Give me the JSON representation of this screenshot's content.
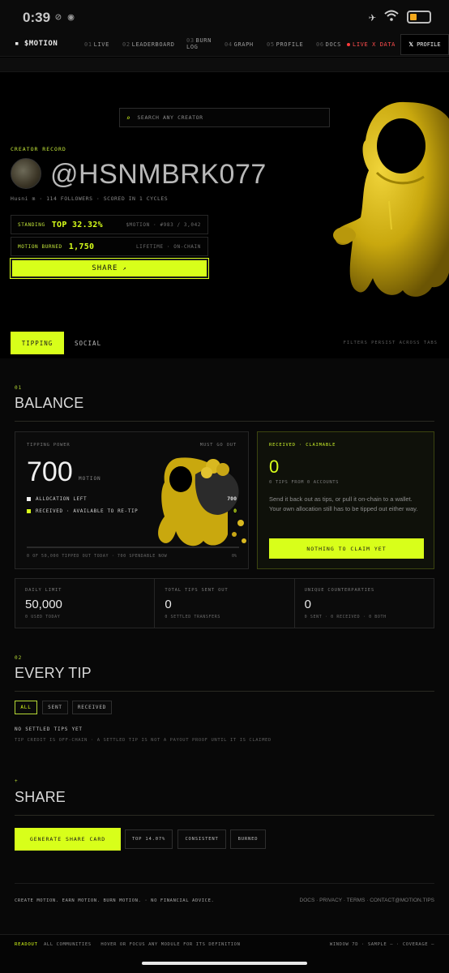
{
  "status_bar": {
    "time": "0:39"
  },
  "nav": {
    "brand": "$MOTION",
    "items": [
      {
        "num": "01",
        "label": "LIVE"
      },
      {
        "num": "02",
        "label": "LEADERBOARD"
      },
      {
        "num": "03",
        "label": "BURN"
      },
      {
        "num": "",
        "label": "LOG"
      },
      {
        "num": "04",
        "label": "GRAPH"
      },
      {
        "num": "05",
        "label": "PROFILE"
      },
      {
        "num": "06",
        "label": "DOCS"
      }
    ],
    "live": "LIVE X DATA",
    "profile_button": "PROFILE"
  },
  "hero": {
    "search_placeholder": "SEARCH ANY CREATOR",
    "creator_label": "CREATOR RECORD",
    "handle": "@HSNMBRK077",
    "meta": "Husni m · 114 FOLLOWERS · SCORED IN 1 CYCLES",
    "standing": {
      "label": "STANDING",
      "value": "TOP 32.32%",
      "right": "$MOTION · #983 / 3,042"
    },
    "burned": {
      "label": "MOTION BURNED",
      "value": "1,750",
      "right": "LIFETIME · ON-CHAIN"
    },
    "share_button": "SHARE",
    "share_arrow": "↗"
  },
  "tabs": {
    "active": "TIPPING",
    "other": "SOCIAL",
    "note": "FILTERS PERSIST ACROSS TABS"
  },
  "balance": {
    "num": "01",
    "title": "BALANCE",
    "power": {
      "label": "TIPPING POWER",
      "must": "MUST GO OUT",
      "value": "700",
      "unit": "MOTION",
      "allocation_label": "ALLOCATION LEFT",
      "allocation_value": "700",
      "received_label": "RECEIVED · AVAILABLE TO RE-TIP",
      "received_value": "0",
      "footer": "0 OF 50,000 TIPPED OUT TODAY · 700 SPENDABLE NOW",
      "pct": "0%",
      "progress": 0
    },
    "claim": {
      "label": "RECEIVED · CLAIMABLE",
      "value": "0",
      "sub": "0 TIPS FROM 0 ACCOUNTS",
      "text": "Send it back out as tips, or pull it on-chain to a wallet. Your own allocation still has to be tipped out either way.",
      "button": "NOTHING TO CLAIM YET"
    },
    "stats": [
      {
        "label": "DAILY LIMIT",
        "value": "50,000",
        "sub": "0 USED TODAY"
      },
      {
        "label": "TOTAL TIPS SENT OUT",
        "value": "0",
        "sub": "0 SETTLED TRANSFERS"
      },
      {
        "label": "UNIQUE COUNTERPARTIES",
        "value": "0",
        "sub": "0 SENT · 0 RECEIVED · 0 BOTH"
      }
    ]
  },
  "every_tip": {
    "num": "02",
    "title": "EVERY TIP",
    "filters": [
      "ALL",
      "SENT",
      "RECEIVED"
    ],
    "empty": "NO SETTLED TIPS YET",
    "disclaimer": "TIP CREDIT IS OFF-CHAIN · A SETTLED TIP IS NOT A PAYOUT PROOF UNTIL IT IS CLAIMED"
  },
  "share": {
    "num": "+",
    "title": "SHARE",
    "generate": "GENERATE SHARE CARD",
    "chips": [
      "TOP 14.07%",
      "CONSISTENT",
      "BURNED"
    ]
  },
  "footer": {
    "left": "CREATE MOTION. EARN MOTION. BURN MOTION. · NO FINANCIAL ADVICE.",
    "right": "DOCS · PRIVACY · TERMS · CONTACT@MOTION.TIPS"
  },
  "readout": {
    "label": "READOUT",
    "middle": "ALL COMMUNITIES   HOVER OR FOCUS ANY MODULE FOR ITS DEFINITION",
    "right": "WINDOW 7D · SAMPLE — · COVERAGE —"
  },
  "colors": {
    "accent": "#d8ff1a",
    "live": "#ff4d4d",
    "background": "#000000"
  }
}
